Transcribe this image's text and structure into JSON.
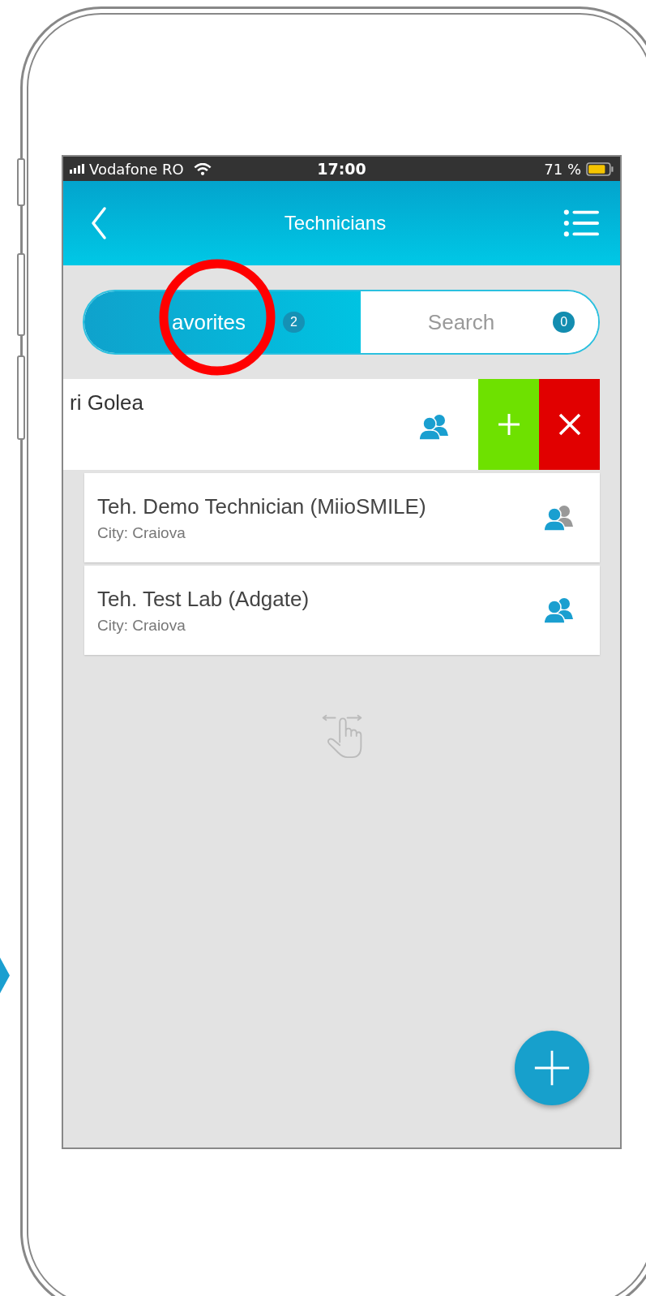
{
  "status_bar": {
    "carrier": "Vodafone RO",
    "time": "17:00",
    "battery": "71 %"
  },
  "header": {
    "title": "Technicians"
  },
  "tabs": [
    {
      "label": "avorites",
      "count": "2",
      "selected": true
    },
    {
      "label": "Search",
      "count": "0",
      "selected": false
    }
  ],
  "rows": [
    {
      "kind": "swiped",
      "name": "ri Golea",
      "second_member_active": true
    },
    {
      "kind": "card",
      "name": "Teh. Demo Technician (MiioSMILE)",
      "city": "City: Craiova",
      "second_member_active": false
    },
    {
      "kind": "card",
      "name": "Teh. Test Lab (Adgate)",
      "city": "City: Craiova",
      "second_member_active": true
    }
  ]
}
